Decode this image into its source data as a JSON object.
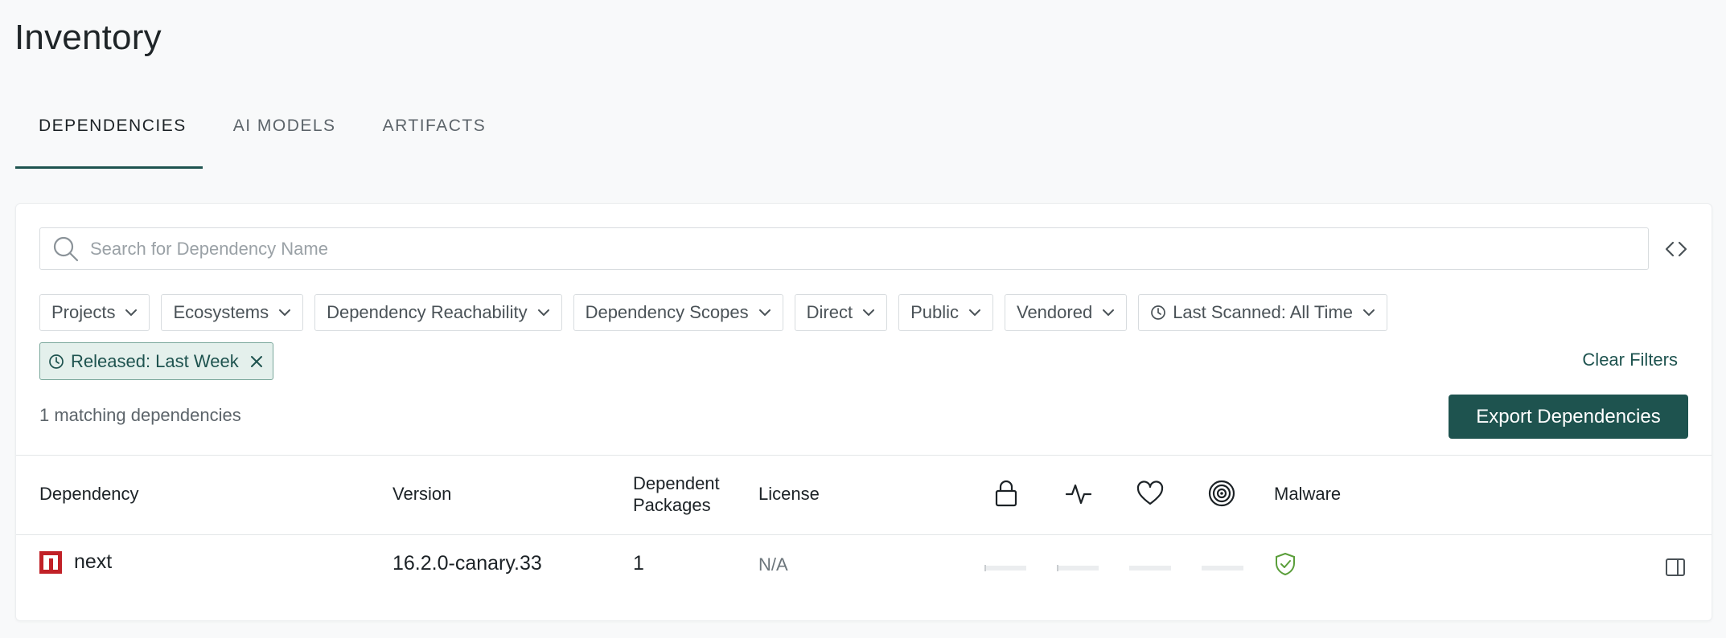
{
  "page": {
    "title": "Inventory"
  },
  "tabs": [
    {
      "label": "DEPENDENCIES",
      "active": true
    },
    {
      "label": "AI MODELS",
      "active": false
    },
    {
      "label": "ARTIFACTS",
      "active": false
    }
  ],
  "search": {
    "placeholder": "Search for Dependency Name",
    "value": ""
  },
  "filters": [
    {
      "label": "Projects"
    },
    {
      "label": "Ecosystems"
    },
    {
      "label": "Dependency Reachability"
    },
    {
      "label": "Dependency Scopes"
    },
    {
      "label": "Direct"
    },
    {
      "label": "Public"
    },
    {
      "label": "Vendored"
    },
    {
      "label": "Last Scanned: All Time",
      "icon": "clock-icon"
    }
  ],
  "active_filter": {
    "label": "Released: Last Week",
    "icon": "clock-icon"
  },
  "clear_filters_label": "Clear Filters",
  "match_count": "1 matching dependencies",
  "export_label": "Export Dependencies",
  "table": {
    "columns": {
      "dependency": "Dependency",
      "version": "Version",
      "dependent_line1": "Dependent",
      "dependent_line2": "Packages",
      "license": "License",
      "security_icon": "lock-icon",
      "activity_icon": "activity-icon",
      "popularity_icon": "heart-icon",
      "code_quality_icon": "target-icon",
      "malware": "Malware"
    },
    "rows": [
      {
        "logo_icon": "npm-icon",
        "name": "next",
        "version": "16.2.0-canary.33",
        "dependent_packages": "1",
        "license": "N/A",
        "malware_icon": "shield-check-icon"
      }
    ]
  },
  "colors": {
    "accent": "#1e534f",
    "chip_bg": "#e4f0ec",
    "npm": "#c12127",
    "safe": "#5a9e3a"
  }
}
